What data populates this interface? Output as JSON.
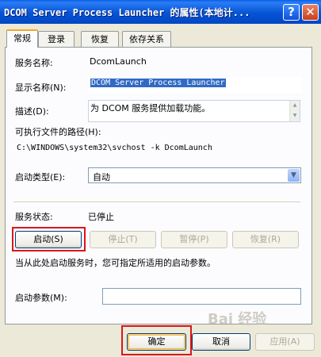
{
  "window": {
    "title": "DCOM Server Process Launcher 的属性(本地计...",
    "help_glyph": "?",
    "close_glyph": "✕"
  },
  "tabs": [
    {
      "label": "常规",
      "active": true
    },
    {
      "label": "登录",
      "active": false
    },
    {
      "label": "恢复",
      "active": false
    },
    {
      "label": "依存关系",
      "active": false
    }
  ],
  "general": {
    "service_name_label": "服务名称:",
    "service_name_value": "DcomLaunch",
    "display_name_label": "显示名称(N):",
    "display_name_value": "DCOM Server Process Launcher",
    "description_label": "描述(D):",
    "description_value": "为 DCOM 服务提供加载功能。",
    "path_label": "可执行文件的路径(H):",
    "path_value": "C:\\WINDOWS\\system32\\svchost -k DcomLaunch",
    "startup_type_label": "启动类型(E):",
    "startup_type_value": "自动",
    "status_label": "服务状态:",
    "status_value": "已停止",
    "start_button": "启动(S)",
    "stop_button": "停止(T)",
    "pause_button": "暂停(P)",
    "resume_button": "恢复(R)",
    "hint_text": "当从此处启动服务时，您可指定所适用的启动参数。",
    "params_label": "启动参数(M):",
    "params_value": ""
  },
  "footer": {
    "ok_button": "确定",
    "cancel_button": "取消",
    "apply_button": "应用(A)"
  },
  "watermark": "Bai 经验",
  "colors": {
    "titlebar": "#0454d6",
    "dialog_bg": "#ece9d8",
    "highlight_box": "#d9171c",
    "selection": "#316ac5"
  }
}
